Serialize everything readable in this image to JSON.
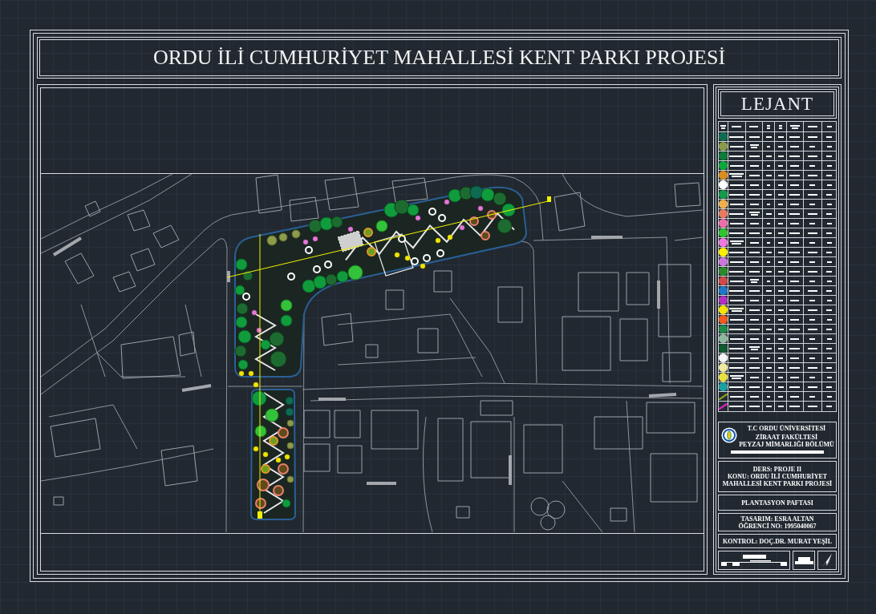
{
  "title": "ORDU İLİ CUMHURİYET MAHALLESİ KENT PARKI PROJESİ",
  "legend": {
    "title": "LEJANT",
    "items": [
      {
        "kind": "circle",
        "color": "#0e6b4f"
      },
      {
        "kind": "circle",
        "color": "#8a9a4a"
      },
      {
        "kind": "circle",
        "color": "#0f7a3a"
      },
      {
        "kind": "circle",
        "color": "#0ca83a"
      },
      {
        "kind": "circle",
        "color": "#d98c1f"
      },
      {
        "kind": "circle",
        "color": "#ffffff"
      },
      {
        "kind": "circle",
        "color": "#139a4a"
      },
      {
        "kind": "circle",
        "color": "#f0b050"
      },
      {
        "kind": "circle",
        "color": "#e87a60"
      },
      {
        "kind": "circle",
        "color": "#ee6fa8"
      },
      {
        "kind": "circle",
        "color": "#2fc42f"
      },
      {
        "kind": "circle",
        "color": "#ee78e0"
      },
      {
        "kind": "circle",
        "color": "#ffee00"
      },
      {
        "kind": "circle",
        "color": "#cc77dd"
      },
      {
        "kind": "circle",
        "color": "#2a8a2a"
      },
      {
        "kind": "circle",
        "color": "#d04848"
      },
      {
        "kind": "circle",
        "color": "#1e78c8"
      },
      {
        "kind": "circle",
        "color": "#b030c0"
      },
      {
        "kind": "circle",
        "color": "#f5e400"
      },
      {
        "kind": "circle",
        "color": "#f05a1e"
      },
      {
        "kind": "circle",
        "color": "#1f8a4a"
      },
      {
        "kind": "circle",
        "color": "#8fb8a0"
      },
      {
        "kind": "circle",
        "color": "#0f5a2e"
      },
      {
        "kind": "circle",
        "color": "#f4f4f4"
      },
      {
        "kind": "circle",
        "color": "#f0e8a0"
      },
      {
        "kind": "circle",
        "color": "#e8e040"
      },
      {
        "kind": "circle",
        "color": "#1aa0a0"
      },
      {
        "kind": "line",
        "color": "#8aa020"
      },
      {
        "kind": "line",
        "color": "#e020c0"
      }
    ]
  },
  "title_block": {
    "university": "T.C ORDU ÜNİVERSİTESİ",
    "faculty": "ZİRAAT FAKÜLTESİ",
    "department": "PEYZAJ MİMARLIĞI BÖLÜMÜ",
    "course": "DERS: PROJE II",
    "subject": "KONU: ORDU İLİ CUMHURİYET MAHALLESİ KENT PARKI PROJESİ",
    "sheet": "PLANTASYON PAFTASI",
    "designer": "TASARIM: ESRA ALTAN",
    "student_no": "ÖĞRENCİ NO: 1995040067",
    "supervisor": "KONTROL: DOÇ.DR. MURAT YEŞİL"
  }
}
